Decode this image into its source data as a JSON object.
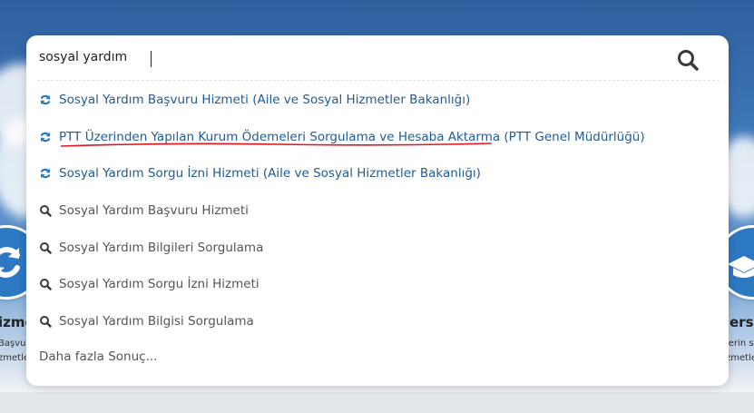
{
  "search": {
    "value": "sosyal yardım",
    "button_icon": "search-icon"
  },
  "results": {
    "services": [
      {
        "label": "Sosyal Yardım Başvuru Hizmeti (Aile ve Sosyal Hizmetler Bakanlığı)",
        "icon": "service-refresh-icon"
      },
      {
        "label": "PTT Üzerinden Yapılan Kurum Ödemeleri Sorgulama ve Hesaba Aktarma (PTT Genel Müdürlüğü)",
        "icon": "service-refresh-icon"
      },
      {
        "label": "Sosyal Yardım Sorgu İzni Hizmeti (Aile ve Sosyal Hizmetler Bakanlığı)",
        "icon": "service-refresh-icon"
      }
    ],
    "searches": [
      {
        "label": "Sosyal Yardım Başvuru Hizmeti",
        "icon": "search-icon"
      },
      {
        "label": "Sosyal Yardım Bilgileri Sorgulama",
        "icon": "search-icon"
      },
      {
        "label": "Sosyal Yardım Sorgu İzni Hizmeti",
        "icon": "search-icon"
      },
      {
        "label": "Sosyal Yardım Bilgisi Sorgulama",
        "icon": "search-icon"
      }
    ],
    "more_label": "Daha fazla Sonuç..."
  },
  "background_tiles": {
    "left": {
      "title": "izme",
      "desc1": "Başvu",
      "desc2": "zmetle",
      "icon": "refresh-icon"
    },
    "right": {
      "title": "ersit",
      "desc1": "lerin s",
      "desc2": "zmetler",
      "icon": "graduation-cap-icon"
    }
  },
  "colors": {
    "link": "#225b96",
    "icon_blue": "#2d78c3",
    "highlight_underline": "#e0141e"
  }
}
